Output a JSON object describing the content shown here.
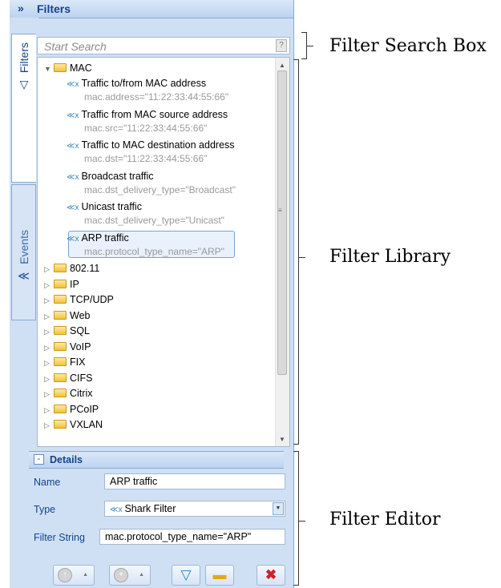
{
  "panel": {
    "title": "Filters",
    "collapse_glyph": "»",
    "tabs": [
      {
        "label": "Filters",
        "icon": "filter-icon",
        "glyph": "▽"
      },
      {
        "label": "Events",
        "icon": "events-icon",
        "glyph": "≪"
      }
    ]
  },
  "search": {
    "placeholder": "Start Search",
    "button_glyph": "?"
  },
  "tree": {
    "mac_folder": "MAC",
    "mac_items": [
      {
        "title": "Traffic to/from MAC address",
        "filter": "mac.address=\"11:22:33:44:55:66\""
      },
      {
        "title": "Traffic from MAC source address",
        "filter": "mac.src=\"11:22:33:44:55:66\""
      },
      {
        "title": "Traffic to MAC destination address",
        "filter": "mac.dst=\"11:22:33:44:55:66\""
      },
      {
        "title": "Broadcast traffic",
        "filter": "mac.dst_delivery_type=\"Broadcast\""
      },
      {
        "title": "Unicast traffic",
        "filter": "mac.dst_delivery_type=\"Unicast\""
      },
      {
        "title": "ARP traffic",
        "filter": "mac.protocol_type_name=\"ARP\""
      }
    ],
    "selected_index": 5,
    "folders": [
      "802.11",
      "IP",
      "TCP/UDP",
      "Web",
      "SQL",
      "VoIP",
      "FIX",
      "CIFS",
      "Citrix",
      "PCoIP",
      "VXLAN"
    ],
    "item_glyph": "≪x"
  },
  "details": {
    "header": "Details",
    "toggle_glyph": "-",
    "name_label": "Name",
    "name_value": "ARP traffic",
    "type_label": "Type",
    "type_value": "Shark Filter",
    "type_glyph": "≪x",
    "string_label": "Filter String",
    "string_value": "mac.protocol_type_name=\"ARP\""
  },
  "toolbar": {
    "buttons": [
      {
        "name": "move-up-button",
        "icon": "up-circle-icon"
      },
      {
        "name": "add-button",
        "icon": "add-circle-icon"
      },
      {
        "name": "apply-filter-button",
        "icon": "apply-filter-icon"
      },
      {
        "name": "new-folder-button",
        "icon": "new-folder-icon"
      },
      {
        "name": "delete-button",
        "icon": "delete-icon"
      }
    ]
  },
  "annotations": {
    "search": "Filter Search Box",
    "library": "Filter Library",
    "editor": "Filter Editor"
  },
  "colors": {
    "accent": "#15428b",
    "panel_bg": "#cfe0f5",
    "border": "#8aa9cf",
    "delete": "#d0202a"
  }
}
